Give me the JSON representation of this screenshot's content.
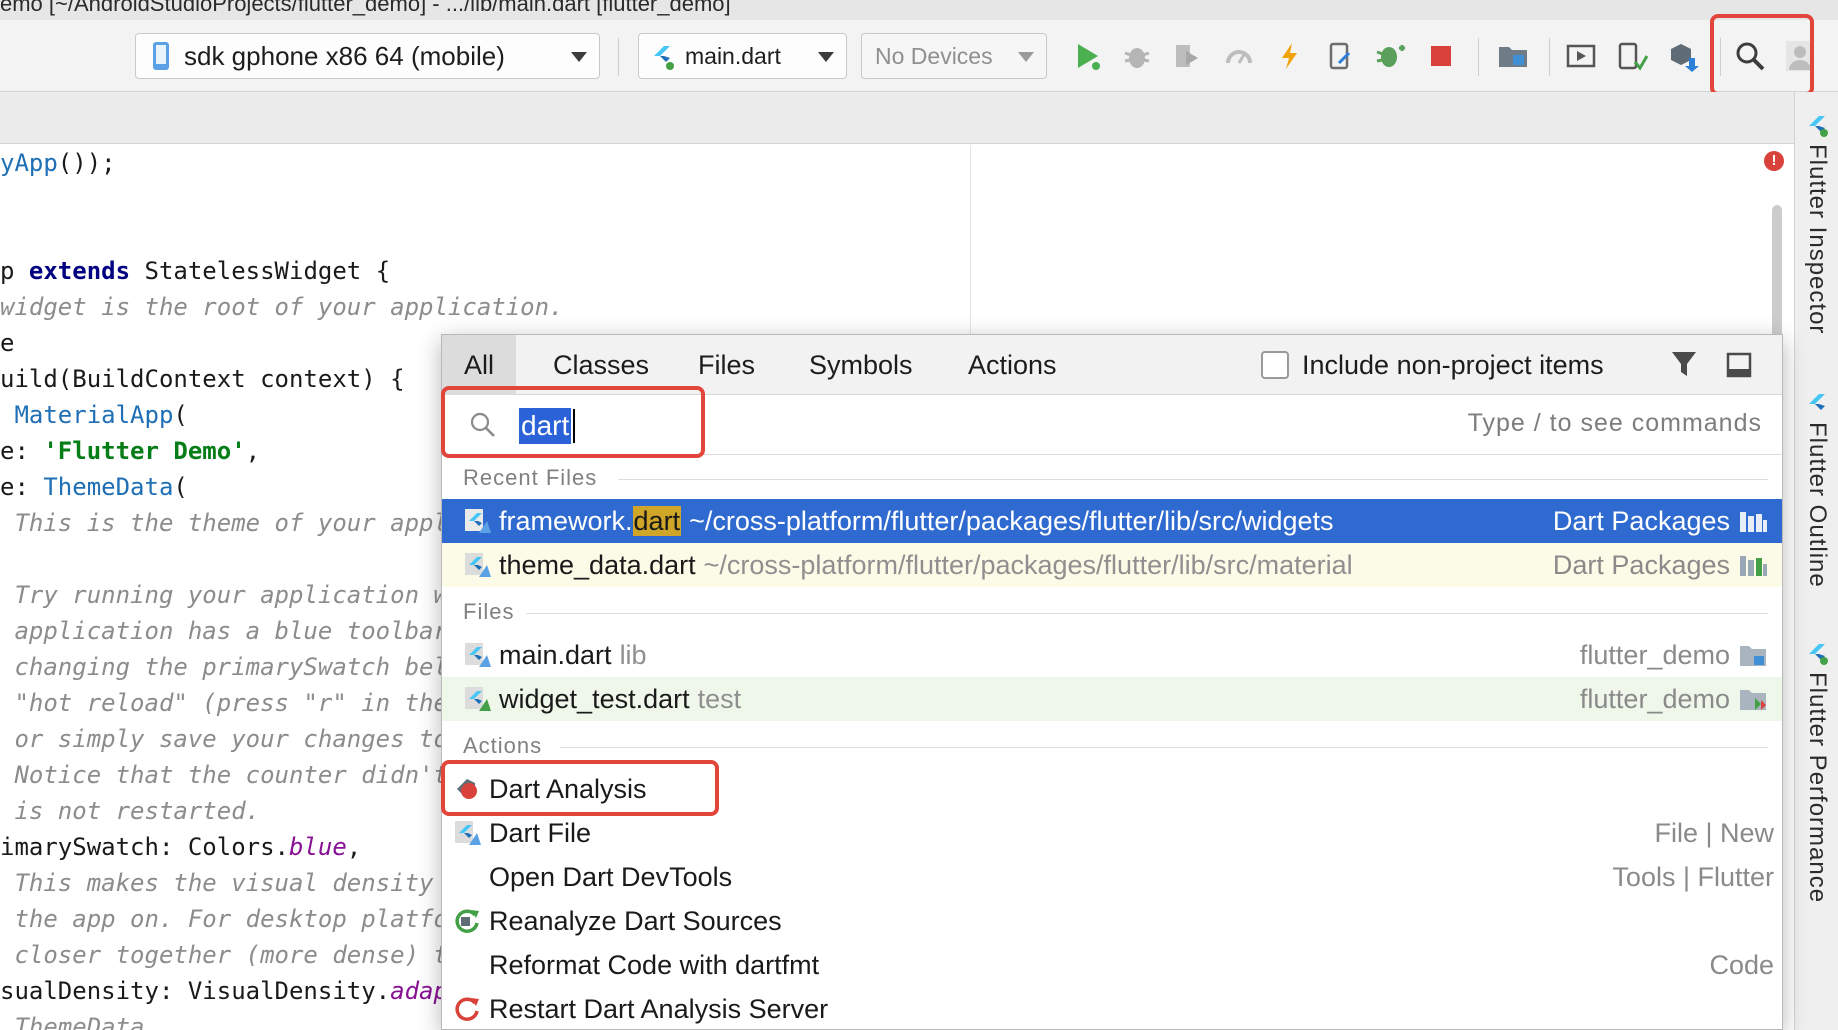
{
  "window": {
    "title": "emo [~/AndroidStudioProjects/flutter_demo] - .../lib/main.dart [flutter_demo]"
  },
  "toolbar": {
    "device_selector": "sdk gphone x86 64 (mobile)",
    "run_config": "main.dart",
    "devices_selector": "No Devices",
    "icons": [
      "run-icon",
      "debug-icon",
      "run-with-coverage-icon",
      "profile-icon",
      "hot-reload-icon",
      "attach-debugger-icon",
      "apply-changes-icon",
      "stop-icon",
      "project-structure-icon",
      "avd-manager-icon",
      "sdk-manager-icon",
      "sync-project-icon",
      "search-everywhere-icon",
      "account-icon"
    ],
    "colors": {
      "run": "#4caf50",
      "stop": "#d9423a",
      "hot_reload": "#f0a30a",
      "highlight": "#e2463a"
    }
  },
  "editor": {
    "lines": [
      [
        {
          "t": "yApp",
          "c": "cls"
        },
        {
          "t": "());"
        }
      ],
      [],
      [],
      [
        {
          "t": "p "
        },
        {
          "t": "extends",
          "c": "kw"
        },
        {
          "t": " StatelessWidget {"
        }
      ],
      [
        {
          "t": "widget is the root of your application.",
          "c": "cmt"
        }
      ],
      [
        {
          "t": "e"
        }
      ],
      [
        {
          "t": "uild(BuildContext context) {"
        }
      ],
      [
        {
          "t": " "
        },
        {
          "t": "MaterialApp",
          "c": "cls"
        },
        {
          "t": "("
        }
      ],
      [
        {
          "t": "e: "
        },
        {
          "t": "'Flutter Demo'",
          "c": "str"
        },
        {
          "t": ","
        }
      ],
      [
        {
          "t": "e: "
        },
        {
          "t": "ThemeData",
          "c": "cls"
        },
        {
          "t": "("
        }
      ],
      [
        {
          "t": " This is the theme of your appli",
          "c": "cmt"
        }
      ],
      [],
      [
        {
          "t": " Try running your application wi",
          "c": "cmt"
        }
      ],
      [
        {
          "t": " application has a blue toolbar.",
          "c": "cmt"
        }
      ],
      [
        {
          "t": " changing the primarySwatch belo",
          "c": "cmt"
        }
      ],
      [
        {
          "t": " \"hot reload\" (press \"r\" in the",
          "c": "cmt"
        }
      ],
      [
        {
          "t": " or simply save your changes to",
          "c": "cmt"
        }
      ],
      [
        {
          "t": " Notice that the counter didn't",
          "c": "cmt"
        }
      ],
      [
        {
          "t": " is not restarted.",
          "c": "cmt"
        }
      ],
      [
        {
          "t": "imarySwatch: Colors."
        },
        {
          "t": "blue",
          "c": "ital"
        },
        {
          "t": ","
        }
      ],
      [
        {
          "t": " This makes the visual density a",
          "c": "cmt"
        }
      ],
      [
        {
          "t": " the app on. For desktop platfor",
          "c": "cmt"
        }
      ],
      [
        {
          "t": " closer together (more dense) th",
          "c": "cmt"
        }
      ],
      [
        {
          "t": "sualDensity: VisualDensity."
        },
        {
          "t": "adapt",
          "c": "ital"
        }
      ],
      [
        {
          "t": " ThemeData",
          "c": "cmt"
        }
      ]
    ]
  },
  "side_panel": {
    "tabs": [
      "Flutter Inspector",
      "Flutter Outline",
      "Flutter Performance"
    ]
  },
  "search_popup": {
    "tabs": [
      "All",
      "Classes",
      "Files",
      "Symbols",
      "Actions"
    ],
    "active_tab": "All",
    "include_non_project_label": "Include non-project items",
    "include_non_project_checked": false,
    "query": "dart",
    "hint": "Type / to see commands",
    "recent_files_header": "Recent Files",
    "recent_files": [
      {
        "name_before": "framework.",
        "name_match": "dart",
        "path": "~/cross-platform/flutter/packages/flutter/lib/src/widgets",
        "location": "Dart Packages",
        "selected": true
      },
      {
        "name_before": "theme_data.dart",
        "name_match": "",
        "path": "~/cross-platform/flutter/packages/flutter/lib/src/material",
        "location": "Dart Packages",
        "selected": false
      }
    ],
    "files_header": "Files",
    "files": [
      {
        "name": "main.dart",
        "dir": "lib",
        "module": "flutter_demo"
      },
      {
        "name": "widget_test.dart",
        "dir": "test",
        "module": "flutter_demo"
      }
    ],
    "actions_header": "Actions",
    "actions": [
      {
        "label": "Dart Analysis",
        "group": "",
        "icon": "dart-analysis-icon"
      },
      {
        "label": "Dart File",
        "group": "File | New",
        "icon": "dart-file-icon"
      },
      {
        "label": "Open Dart DevTools",
        "group": "Tools | Flutter",
        "icon": ""
      },
      {
        "label": "Reanalyze Dart Sources",
        "group": "",
        "icon": "reanalyze-icon"
      },
      {
        "label": "Reformat Code with dartfmt",
        "group": "Code",
        "icon": ""
      },
      {
        "label": "Restart Dart Analysis Server",
        "group": "",
        "icon": "restart-icon"
      }
    ]
  }
}
